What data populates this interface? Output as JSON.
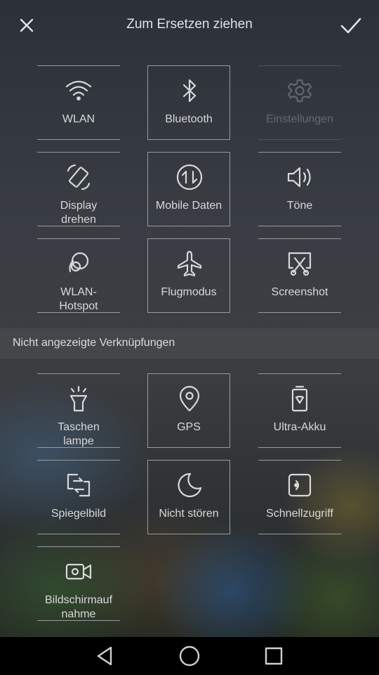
{
  "header": {
    "title": "Zum Ersetzen ziehen",
    "close_icon": "close-icon",
    "confirm_icon": "checkmark-icon"
  },
  "active_tiles": [
    {
      "label": "WLAN",
      "icon": "wifi-icon"
    },
    {
      "label": "Bluetooth",
      "icon": "bluetooth-icon"
    },
    {
      "label": "Einstellungen",
      "icon": "gear-icon",
      "state": "faded"
    },
    {
      "label": "Display drehen",
      "icon": "rotate-screen-icon"
    },
    {
      "label": "Mobile Daten",
      "icon": "mobile-data-icon"
    },
    {
      "label": "Töne",
      "icon": "speaker-icon"
    },
    {
      "label": "WLAN-Hotspot",
      "icon": "hotspot-icon"
    },
    {
      "label": "Flugmodus",
      "icon": "airplane-icon"
    },
    {
      "label": "Screenshot",
      "icon": "screenshot-icon"
    }
  ],
  "hidden_section": {
    "title": "Nicht angezeigte Verknüpfungen"
  },
  "hidden_tiles": [
    {
      "label": "Taschen lampe",
      "icon": "flashlight-icon"
    },
    {
      "label": "GPS",
      "icon": "location-pin-icon"
    },
    {
      "label": "Ultra-Akku",
      "icon": "battery-icon"
    },
    {
      "label": "Spiegelbild",
      "icon": "mirror-icon"
    },
    {
      "label": "Nicht stören",
      "icon": "moon-icon"
    },
    {
      "label": "Schnellzugriff",
      "icon": "quick-access-icon"
    },
    {
      "label": "Bildschirmauf nahme",
      "icon": "video-camera-icon"
    }
  ],
  "navbar": {
    "back_icon": "back-triangle-icon",
    "home_icon": "home-circle-icon",
    "recents_icon": "recents-square-icon"
  }
}
